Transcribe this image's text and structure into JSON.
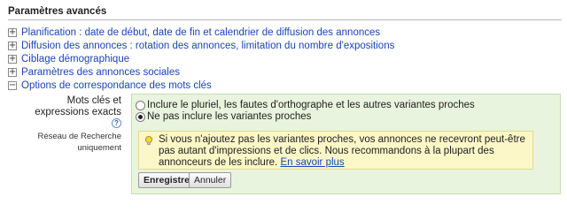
{
  "header": {
    "title": "Paramètres avancés"
  },
  "accordion": [
    {
      "label": "Planification : date de début, date de fin et calendrier de diffusion des annonces",
      "toggle": "+"
    },
    {
      "label": "Diffusion des annonces : rotation des annonces, limitation du nombre d'expositions",
      "toggle": "+"
    },
    {
      "label": "Ciblage démographique",
      "toggle": "+"
    },
    {
      "label": "Paramètres des annonces sociales",
      "toggle": "+"
    },
    {
      "label": "Options de correspondance des mots clés",
      "toggle": "−"
    }
  ],
  "keyword_options": {
    "label": "Mots clés et expressions exacts",
    "help": "?",
    "sublabel": "Réseau de Recherche uniquement",
    "options": [
      {
        "label": "Inclure le pluriel, les fautes d'orthographe et les autres variantes proches",
        "selected": false
      },
      {
        "label": "Ne pas inclure les variantes proches",
        "selected": true
      }
    ],
    "notice": {
      "text": "Si vous n'ajoutez pas les variantes proches, vos annonces ne recevront peut-être pas autant d'impressions et de clics. Nous recommandons à la plupart des annonceurs de les inclure.",
      "link": "En savoir plus"
    },
    "save_label": "Enregistrer",
    "cancel_label": "Annuler"
  },
  "colors": {
    "link": "#1a44b8",
    "panel_bg": "#e8f4dd",
    "notice_bg": "#fbf7c7"
  }
}
